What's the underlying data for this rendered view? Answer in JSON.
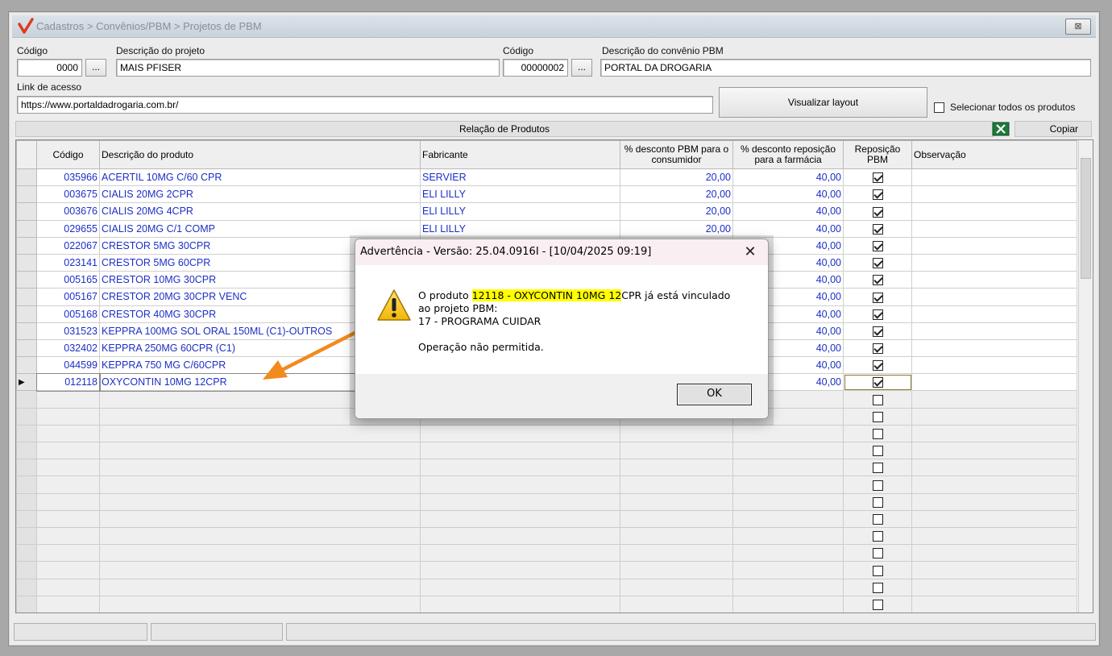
{
  "window": {
    "breadcrumb": "Cadastros > Convênios/PBM > Projetos de PBM",
    "close_label": "⊠"
  },
  "form": {
    "codigo_label": "Código",
    "codigo_value": "0000",
    "descricao_projeto_label": "Descrição do projeto",
    "descricao_projeto_value": "MAIS PFISER",
    "codigo_convenio_label": "Código",
    "codigo_convenio_value": "00000002",
    "descricao_convenio_label": "Descrição do convênio PBM",
    "descricao_convenio_value": "PORTAL DA DROGARIA",
    "ellipsis": "...",
    "link_label": "Link de acesso",
    "link_value": "https://www.portaldadrogaria.com.br/",
    "visualizar_button": "Visualizar layout",
    "selecionar_todos": "Selecionar todos os produtos",
    "relacao_title": "Relação de Produtos",
    "copiar_button": "Copiar"
  },
  "grid": {
    "headers": {
      "codigo": "Código",
      "descricao": "Descrição do produto",
      "fabricante": "Fabricante",
      "desconto_consumidor": "% desconto PBM para o consumidor",
      "desconto_reposicao": "% desconto reposição para a farmácia",
      "reposicao": "Reposição PBM",
      "observacao": "Observação"
    },
    "rows": [
      {
        "codigo": "035966",
        "descricao": "ACERTIL 10MG C/60 CPR",
        "fabricante": "SERVIER",
        "desc_cons": "20,00",
        "desc_rep": "40,00",
        "reposicao": true
      },
      {
        "codigo": "003675",
        "descricao": "CIALIS 20MG 2CPR",
        "fabricante": "ELI LILLY",
        "desc_cons": "20,00",
        "desc_rep": "40,00",
        "reposicao": true
      },
      {
        "codigo": "003676",
        "descricao": "CIALIS 20MG 4CPR",
        "fabricante": "ELI LILLY",
        "desc_cons": "20,00",
        "desc_rep": "40,00",
        "reposicao": true
      },
      {
        "codigo": "029655",
        "descricao": "CIALIS 20MG C/1 COMP",
        "fabricante": "ELI LILLY",
        "desc_cons": "20,00",
        "desc_rep": "40,00",
        "reposicao": true
      },
      {
        "codigo": "022067",
        "descricao": "CRESTOR  5MG 30CPR",
        "fabricante": "",
        "desc_cons": "",
        "desc_rep": "40,00",
        "reposicao": true
      },
      {
        "codigo": "023141",
        "descricao": "CRESTOR  5MG 60CPR",
        "fabricante": "",
        "desc_cons": "",
        "desc_rep": "40,00",
        "reposicao": true
      },
      {
        "codigo": "005165",
        "descricao": "CRESTOR 10MG 30CPR",
        "fabricante": "",
        "desc_cons": "",
        "desc_rep": "40,00",
        "reposicao": true
      },
      {
        "codigo": "005167",
        "descricao": "CRESTOR 20MG 30CPR VENC",
        "fabricante": "",
        "desc_cons": "",
        "desc_rep": "40,00",
        "reposicao": true
      },
      {
        "codigo": "005168",
        "descricao": "CRESTOR 40MG 30CPR",
        "fabricante": "",
        "desc_cons": "",
        "desc_rep": "40,00",
        "reposicao": true
      },
      {
        "codigo": "031523",
        "descricao": "KEPPRA 100MG SOL ORAL 150ML (C1)-OUTROS",
        "fabricante": "",
        "desc_cons": "",
        "desc_rep": "40,00",
        "reposicao": true
      },
      {
        "codigo": "032402",
        "descricao": "KEPPRA 250MG 60CPR (C1)",
        "fabricante": "",
        "desc_cons": "",
        "desc_rep": "40,00",
        "reposicao": true
      },
      {
        "codigo": "044599",
        "descricao": "KEPPRA 750 MG C/60CPR",
        "fabricante": "",
        "desc_cons": "",
        "desc_rep": "40,00",
        "reposicao": true
      },
      {
        "codigo": "012118",
        "descricao": "OXYCONTIN 10MG  12CPR",
        "fabricante": "",
        "desc_cons": "",
        "desc_rep": "40,00",
        "reposicao": true
      }
    ],
    "empty_rows": 13,
    "row_indicator": "▶"
  },
  "dialog": {
    "title": "Advertência - Versão: 25.04.0916I - [10/04/2025 09:19]",
    "close": "✕",
    "msg_prefix": "O produto ",
    "msg_highlight": "12118 - OXYCONTIN 10MG  12",
    "msg_suffix": "CPR já está vinculado",
    "msg_line2": "ao projeto PBM:",
    "msg_line3": "17 - PROGRAMA CUIDAR",
    "msg_line4": "Operação não permitida.",
    "ok_button": "OK"
  },
  "colors": {
    "grid_text": "#1c2fc6",
    "arrow": "#f28a1e",
    "highlight": "#ffff00"
  }
}
